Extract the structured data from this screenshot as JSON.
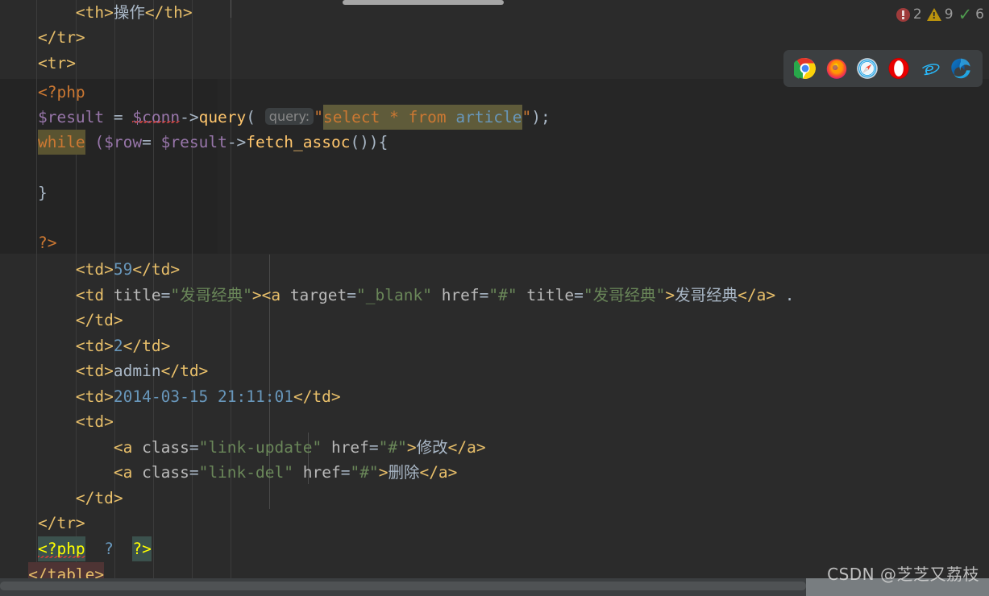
{
  "editor": {
    "theme_bg": "#2b2b2b",
    "php_block_bg": "#262626",
    "lines": [
      {
        "indent": "        ",
        "text": "<th>操作</th>"
      },
      {
        "indent": "    ",
        "text": "</tr>"
      },
      {
        "indent": "    ",
        "text": "<tr>"
      },
      {
        "indent": "    ",
        "text": "<?php"
      },
      {
        "indent": "    ",
        "text": "$result = $conn->query( query: \"select * from article\");"
      },
      {
        "indent": "    ",
        "text": "while ($row= $result->fetch_assoc()){"
      },
      {
        "indent": "",
        "text": ""
      },
      {
        "indent": "    ",
        "text": "}"
      },
      {
        "indent": "",
        "text": ""
      },
      {
        "indent": "    ",
        "text": "?>"
      },
      {
        "indent": "        ",
        "text": "<td>59</td>"
      },
      {
        "indent": "        ",
        "text": "<td title=\"发哥经典\"><a target=\"_blank\" href=\"#\" title=\"发哥经典\">发哥经典</a> ."
      },
      {
        "indent": "        ",
        "text": "</td>"
      },
      {
        "indent": "        ",
        "text": "<td>2</td>"
      },
      {
        "indent": "        ",
        "text": "<td>admin</td>"
      },
      {
        "indent": "        ",
        "text": "<td>2014-03-15 21:11:01</td>"
      },
      {
        "indent": "        ",
        "text": "<td>"
      },
      {
        "indent": "            ",
        "text": "<a class=\"link-update\" href=\"#\">修改</a>"
      },
      {
        "indent": "            ",
        "text": "<a class=\"link-del\" href=\"#\">删除</a>"
      },
      {
        "indent": "        ",
        "text": "</td>"
      },
      {
        "indent": "    ",
        "text": "</tr>"
      },
      {
        "indent": "    ",
        "text": "<?php  ?  ?>"
      },
      {
        "indent": "",
        "text": "</table>"
      }
    ],
    "tokens": {
      "line1_tag_open": "<th>",
      "line1_text": "操作",
      "line1_tag_close": "</th>",
      "line2": "</tr>",
      "line3": "<tr>",
      "line4_php_open": "<?php",
      "line5_var_result": "$result",
      "line5_eq": " = ",
      "line5_var_conn": "$conn",
      "line5_arrow": "->",
      "line5_method": "query",
      "line5_paren_open": "(",
      "line5_hint": "query:",
      "line5_quote1": "\"",
      "line5_sql_select": "select",
      "line5_sql_star": " * ",
      "line5_sql_from": "from",
      "line5_sql_table": " article",
      "line5_quote2": "\"",
      "line5_tail": ");",
      "line6_kw_while": "while",
      "line6_open": " ($",
      "line6_row": "row",
      "line6_eq": "= ",
      "line6_result": "$result",
      "line6_arrow": "->",
      "line6_fetch": "fetch_assoc",
      "line6_tail": "()){",
      "line8_brace": "}",
      "line10_php_close": "?>",
      "line11_td_open": "<td>",
      "line11_val": "59",
      "line11_td_close": "</td>",
      "line12_td_open": "<td ",
      "line12_attr_title": "title",
      "line12_eq": "=",
      "line12_str_title": "\"发哥经典\"",
      "line12_gt": ">",
      "line12_a_open": "<a ",
      "line12_attr_target": "target",
      "line12_str_target": "\"_blank\"",
      "line12_attr_href": "href",
      "line12_str_href": "\"#\"",
      "line12_attr_title2": "title",
      "line12_str_title2": "\"发哥经典\"",
      "line12_gt2": ">",
      "line12_link_text": "发哥经典",
      "line12_a_close": "</a>",
      "line12_trail": " .",
      "line13_td_close": "</td>",
      "line14_td_open": "<td>",
      "line14_val": "2",
      "line14_td_close": "</td>",
      "line15_td_open": "<td>",
      "line15_val": "admin",
      "line15_td_close": "</td>",
      "line16_td_open": "<td>",
      "line16_val": "2014-03-15 21:11:01",
      "line16_td_close": "</td>",
      "line17_td_open": "<td>",
      "line18_a_open": "<a ",
      "line18_attr_class": "class",
      "line18_str_class": "\"link-update\"",
      "line18_attr_href": "href",
      "line18_str_href": "\"#\"",
      "line18_gt": ">",
      "line18_text": "修改",
      "line18_a_close": "</a>",
      "line19_a_open": "<a ",
      "line19_attr_class": "class",
      "line19_str_class": "\"link-del\"",
      "line19_attr_href": "href",
      "line19_str_href": "\"#\"",
      "line19_gt": ">",
      "line19_text": "删除",
      "line19_a_close": "</a>",
      "line20_td_close": "</td>",
      "line21_tr_close": "</tr>",
      "line22_php_open": "<?php",
      "line22_q": "?",
      "line22_php_close": "?>",
      "line23_table_close": "</table>"
    }
  },
  "inspections": {
    "error_icon": "error-circle-icon",
    "error_count": "2",
    "warning_icon": "warning-triangle-icon",
    "warning_count": "9",
    "ok_icon": "checkmark-icon",
    "ok_count": "6",
    "error_color": "#9e3b3b",
    "warning_color": "#b9920e",
    "ok_color": "#4e9a4e"
  },
  "browser_bar": {
    "browsers": [
      {
        "name": "chrome-icon",
        "label": "Chrome"
      },
      {
        "name": "firefox-icon",
        "label": "Firefox"
      },
      {
        "name": "safari-icon",
        "label": "Safari"
      },
      {
        "name": "opera-icon",
        "label": "Opera"
      },
      {
        "name": "ie-icon",
        "label": "Internet Explorer"
      },
      {
        "name": "edge-icon",
        "label": "Edge"
      }
    ]
  },
  "watermark": {
    "text": "CSDN @芝芝又荔枝"
  }
}
